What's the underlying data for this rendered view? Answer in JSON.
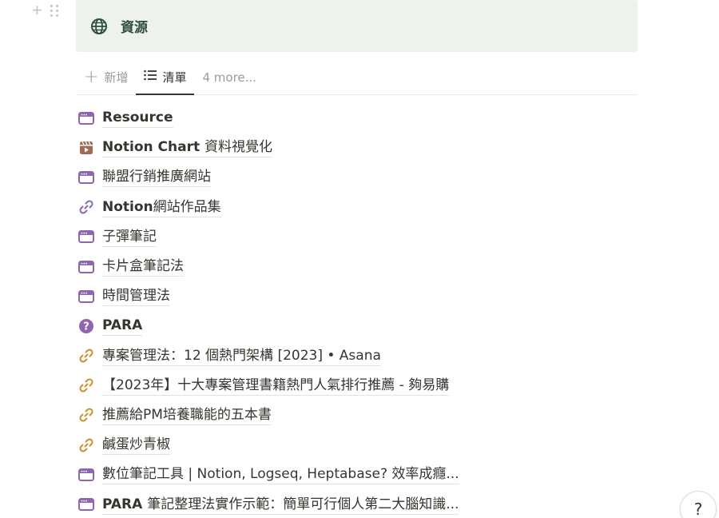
{
  "callout": {
    "icon": "globe-icon",
    "title": "資源",
    "background": "#edf3ec"
  },
  "tabs": {
    "new_label": "新增",
    "list_label": "清單",
    "more_label": "4 more..."
  },
  "items": [
    {
      "icon": "browser-window-icon",
      "bold": "Resource",
      "rest": ""
    },
    {
      "icon": "clapperboard-icon",
      "bold": "Notion Chart ",
      "rest": "資料視覺化"
    },
    {
      "icon": "browser-window-icon",
      "bold": "",
      "rest": "聯盟行銷推廣網站"
    },
    {
      "icon": "link-icon",
      "bold": "Notion",
      "rest": "網站作品集"
    },
    {
      "icon": "browser-window-icon",
      "bold": "",
      "rest": "子彈筆記"
    },
    {
      "icon": "browser-window-icon",
      "bold": "",
      "rest": "卡片盒筆記法"
    },
    {
      "icon": "browser-window-icon",
      "bold": "",
      "rest": "時間管理法"
    },
    {
      "icon": "question-icon",
      "bold": "PARA",
      "rest": ""
    },
    {
      "icon": "link-icon",
      "bold": "",
      "rest": "專案管理法：12 個熱門架構 [2023] • Asana"
    },
    {
      "icon": "link-icon",
      "bold": "",
      "rest": "【2023年】十大專案管理書籍熱門人氣排行推薦 - 夠易購"
    },
    {
      "icon": "link-icon",
      "bold": "",
      "rest": "推薦給PM培養職能的五本書"
    },
    {
      "icon": "link-icon",
      "bold": "",
      "rest": "鹹蛋炒青椒"
    },
    {
      "icon": "browser-window-icon",
      "bold": "",
      "rest": "數位筆記工具 | Notion, Logseq, Heptabase? 效率成癮..."
    },
    {
      "icon": "browser-window-icon",
      "bold": "PARA ",
      "rest": "筆記整理法實作示範：簡單可行個人第二大腦知識..."
    }
  ],
  "colors": {
    "purple_icon": "#9065b0",
    "link_orange": "#cb912f",
    "link_purple": "#9065b0",
    "clapper_brown": "#9f6b53"
  },
  "help_label": "?"
}
